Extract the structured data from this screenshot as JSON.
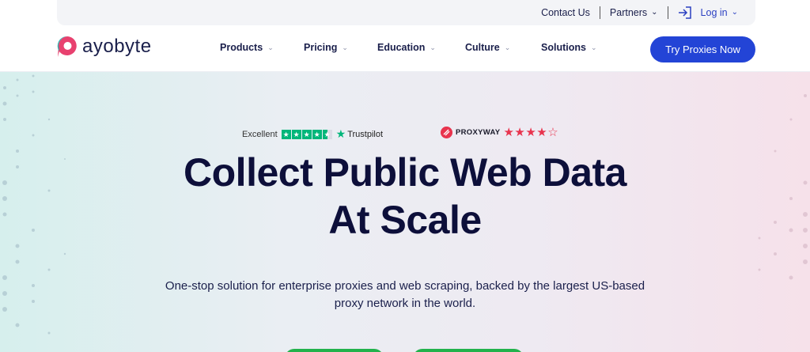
{
  "utility": {
    "contact": "Contact Us",
    "partners": "Partners",
    "login": "Log in"
  },
  "nav": {
    "logo_text": "ayobyte",
    "items": [
      {
        "label": "Products"
      },
      {
        "label": "Pricing"
      },
      {
        "label": "Education"
      },
      {
        "label": "Culture"
      },
      {
        "label": "Solutions"
      }
    ],
    "cta": "Try Proxies Now"
  },
  "ratings": {
    "trustpilot": {
      "prefix": "Excellent",
      "brand": "Trustpilot",
      "stars": 4.5
    },
    "proxyway": {
      "brand": "PROXYWAY",
      "stars": 4,
      "max": 5
    }
  },
  "hero": {
    "headline_line1": "Collect Public Web Data",
    "headline_line2": "At Scale",
    "sub_line1": "One-stop solution for enterprise proxies and web scraping, backed by the largest US-based",
    "sub_line2": "proxy network in the world."
  },
  "colors": {
    "brand_blue": "#2344d6",
    "navy_text": "#0d0f3a",
    "trustpilot_green": "#00b67a",
    "proxyway_red": "#e8344e",
    "logo_teal": "#2ab3b0",
    "logo_pink": "#e8416f"
  },
  "icons": {
    "login": "login-arrow-icon",
    "chevron": "chevron-down-icon"
  }
}
